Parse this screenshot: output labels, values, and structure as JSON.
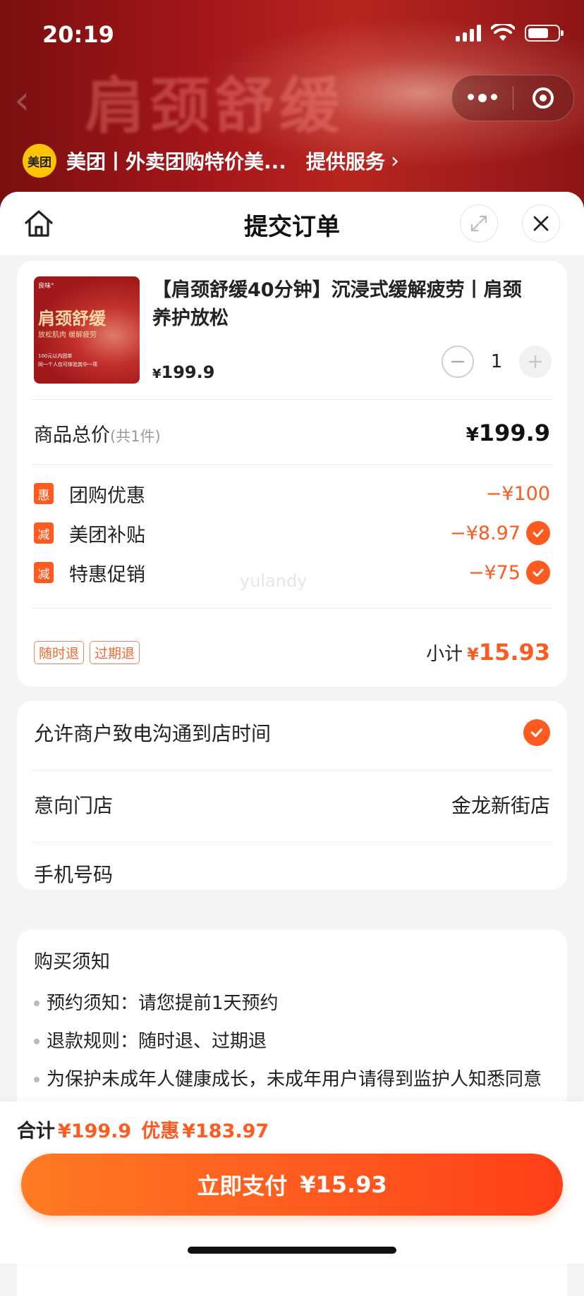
{
  "status_bar": {
    "time": "20:19"
  },
  "hero": {
    "background_text": "肩颈舒缓"
  },
  "provider": {
    "logo_text": "美团",
    "name": "美团丨外卖团购特价美...",
    "service_label": "提供服务",
    "chevron": "›"
  },
  "header": {
    "title": "提交订单"
  },
  "product": {
    "title": "【肩颈舒缓40分钟】沉浸式缓解疲劳丨肩颈养护放松",
    "price_symbol": "¥",
    "price": "199.9",
    "quantity": "1",
    "thumb": {
      "brand": "良味°",
      "headline": "肩颈舒缓",
      "tagline": "放松肌肉  缓解疲劳",
      "small_line_1": "100元以内团单",
      "small_line_2": "同一个人仅可体验其中一项"
    }
  },
  "totals": {
    "label": "商品总价",
    "count_label": "(共1件)",
    "amount_symbol": "¥",
    "amount": "199.9"
  },
  "discounts": [
    {
      "tag": "惠",
      "name": "团购优惠",
      "amount": "−¥100",
      "checked": false
    },
    {
      "tag": "减",
      "name": "美团补贴",
      "amount": "−¥8.97",
      "checked": true
    },
    {
      "tag": "减",
      "name": "特惠促销",
      "amount": "−¥75",
      "checked": true
    }
  ],
  "watermark": "yulandy",
  "refund_tags": [
    "随时退",
    "过期退"
  ],
  "subtotal": {
    "label": "小计",
    "symbol": "¥",
    "amount": "15.93"
  },
  "contact": {
    "allow_call_label": "允许商户致电沟通到店时间",
    "allow_call_checked": true,
    "store_label": "意向门店",
    "store_value": "金龙新街店",
    "phone_label": "手机号码",
    "phone_value": ""
  },
  "notice": {
    "title": "购买须知",
    "items": [
      "预约须知：请您提前1天预约",
      "退款规则：随时退、过期退",
      "为保护未成年人健康成长，未成年用户请得到监护人知悉同意后再进行购买和体验，请勿购买不适合自身年龄段的"
    ]
  },
  "bottom": {
    "sum_label": "合计",
    "sum_value": "¥199.9",
    "discount_label": "优惠",
    "discount_value": "¥183.97",
    "pay_label": "立即支付",
    "pay_amount": "¥15.93"
  },
  "colors": {
    "accent": "#ff5a1f",
    "hero": "#a4161a",
    "brand_yellow": "#ffc300"
  }
}
